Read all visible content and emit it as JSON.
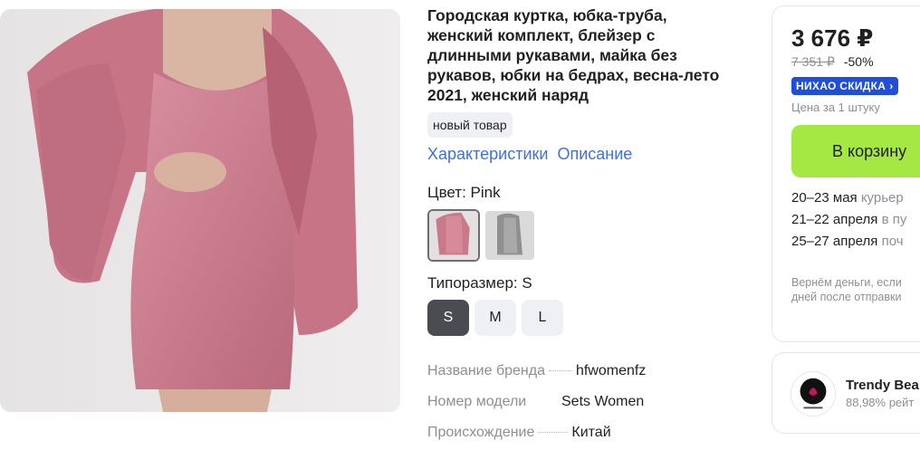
{
  "product": {
    "title": "Городская куртка, юбка-труба, женский комплект, блейзер с длинными рукавами, майка без рукавов, юбки на бедрах, весна-лето 2021, женский наряд",
    "badge": "новый товар",
    "tabs": [
      "Характеристики",
      "Описание"
    ],
    "color_label": "Цвет: Pink",
    "size_label": "Типоразмер: S",
    "sizes": [
      "S",
      "M",
      "L"
    ],
    "selected_size": "S",
    "specs": [
      {
        "key": "Название бренда",
        "value": "hfwomenfz"
      },
      {
        "key": "Номер модели",
        "value": "Sets Women"
      },
      {
        "key": "Происхождение",
        "value": "Китай"
      }
    ]
  },
  "buy": {
    "price": "3 676 ₽",
    "old_price": "7 351 ₽",
    "discount": "-50%",
    "promo": "НИХАО СКИДКА",
    "unit_note": "Цена за 1 штуку",
    "cart_button": "В корзину",
    "delivery": [
      {
        "dates": "20–23 мая",
        "method": "курьер"
      },
      {
        "dates": "21–22 апреля",
        "method": "в пу"
      },
      {
        "dates": "25–27 апреля",
        "method": "поч"
      }
    ],
    "refund_line1": "Вернём деньги, если",
    "refund_line2": "дней после отправки"
  },
  "seller": {
    "name": "Trendy Bea",
    "rating": "88,98% рейт"
  },
  "colors": {
    "accent": "#3f6fe0",
    "promo_bg": "#1f4fd8",
    "cart_bg": "#a5e844",
    "swatch_pink": "#c97a8a",
    "swatch_grey": "#9a9a9a"
  }
}
